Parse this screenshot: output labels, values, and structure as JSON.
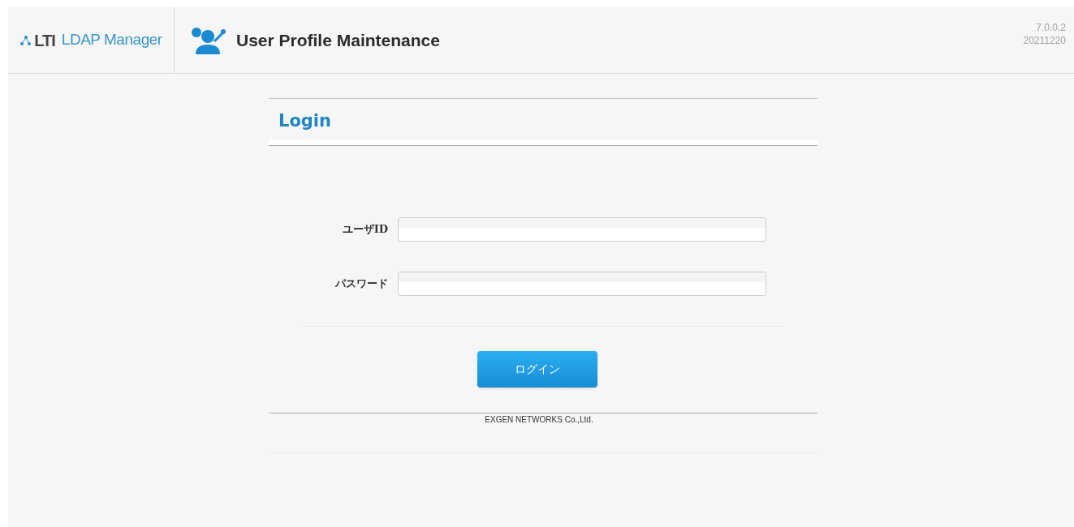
{
  "header": {
    "logo_mark": "LTI",
    "app_name": "LDAP Manager",
    "title": "User Profile Maintenance",
    "version": "7.0.0.2",
    "build": "20211220"
  },
  "login": {
    "heading": "Login",
    "fields": [
      {
        "label": "ユーザID"
      },
      {
        "label": "パスワード"
      }
    ],
    "button": "ログイン"
  },
  "footer": "EXGEN NETWORKS Co.,Ltd."
}
